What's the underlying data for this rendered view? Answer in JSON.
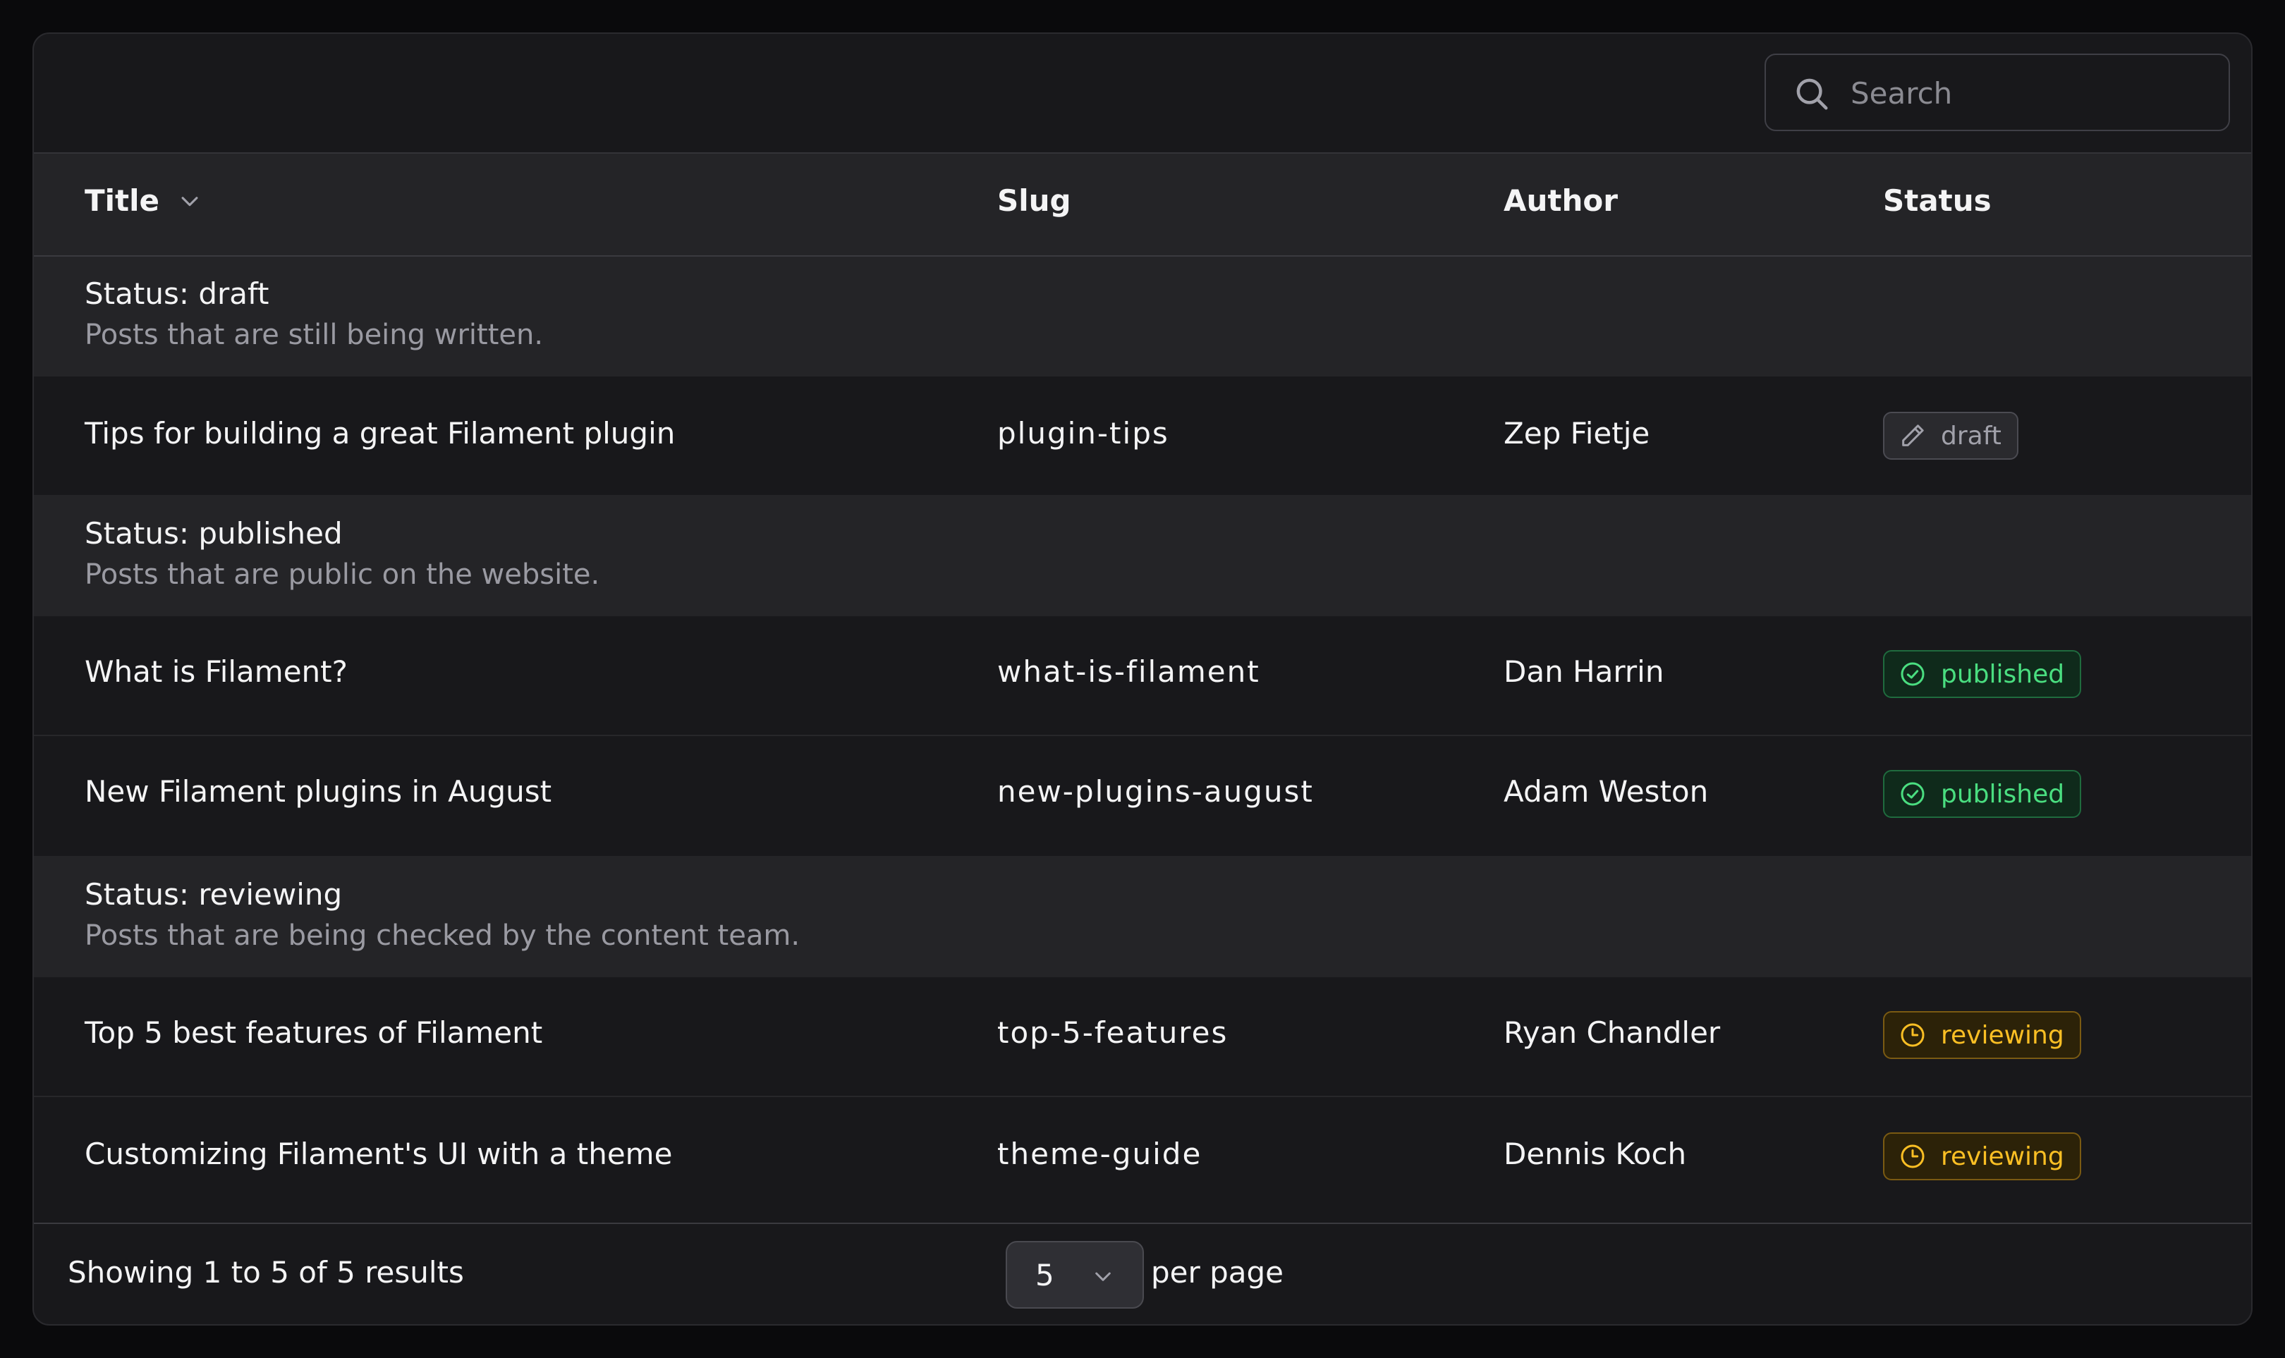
{
  "search": {
    "placeholder": "Search",
    "icon": "search-icon"
  },
  "columns": {
    "title": "Title",
    "slug": "Slug",
    "author": "Author",
    "status": "Status"
  },
  "groups": [
    {
      "title": "Status: draft",
      "description": "Posts that are still being written.",
      "rows": [
        {
          "title": "Tips for building a great Filament plugin",
          "slug": "plugin-tips",
          "author": "Zep Fietje",
          "status": "draft",
          "status_icon": "pencil-icon"
        }
      ]
    },
    {
      "title": "Status: published",
      "description": "Posts that are public on the website.",
      "rows": [
        {
          "title": "What is Filament?",
          "slug": "what-is-filament",
          "author": "Dan Harrin",
          "status": "published",
          "status_icon": "check-circle-icon"
        },
        {
          "title": "New Filament plugins in August",
          "slug": "new-plugins-august",
          "author": "Adam Weston",
          "status": "published",
          "status_icon": "check-circle-icon"
        }
      ]
    },
    {
      "title": "Status: reviewing",
      "description": "Posts that are being checked by the content team.",
      "rows": [
        {
          "title": "Top 5 best features of Filament",
          "slug": "top-5-features",
          "author": "Ryan Chandler",
          "status": "reviewing",
          "status_icon": "clock-icon"
        },
        {
          "title": "Customizing Filament's UI with a theme",
          "slug": "theme-guide",
          "author": "Dennis Koch",
          "status": "reviewing",
          "status_icon": "clock-icon"
        }
      ]
    }
  ],
  "footer": {
    "showing": "Showing 1 to 5 of 5 results",
    "per_page_value": "5",
    "per_page_label": "per page"
  },
  "colors": {
    "published": "#4ade80",
    "reviewing": "#fbbf24",
    "draft": "#a1a1aa"
  }
}
